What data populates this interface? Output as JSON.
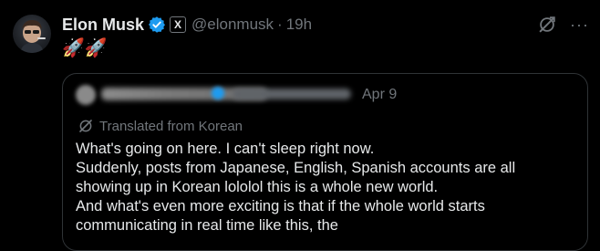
{
  "post": {
    "author_name": "Elon Musk",
    "handle": "@elonmusk",
    "separator": "·",
    "time": "19h",
    "body": "🚀🚀"
  },
  "quote": {
    "date": "Apr 9",
    "translated_label": "Translated from Korean",
    "lines": [
      "What's going on here. I can't sleep right now.",
      "Suddenly, posts from Japanese, English, Spanish accounts are all",
      "showing up in Korean lololol this is a whole new world.",
      "And what's even more exciting is that if the whole world starts",
      "communicating in real time like this, the"
    ]
  },
  "icons": {
    "affiliation_badge": "X",
    "more": "···",
    "verified_color": "#1d9bf0"
  }
}
